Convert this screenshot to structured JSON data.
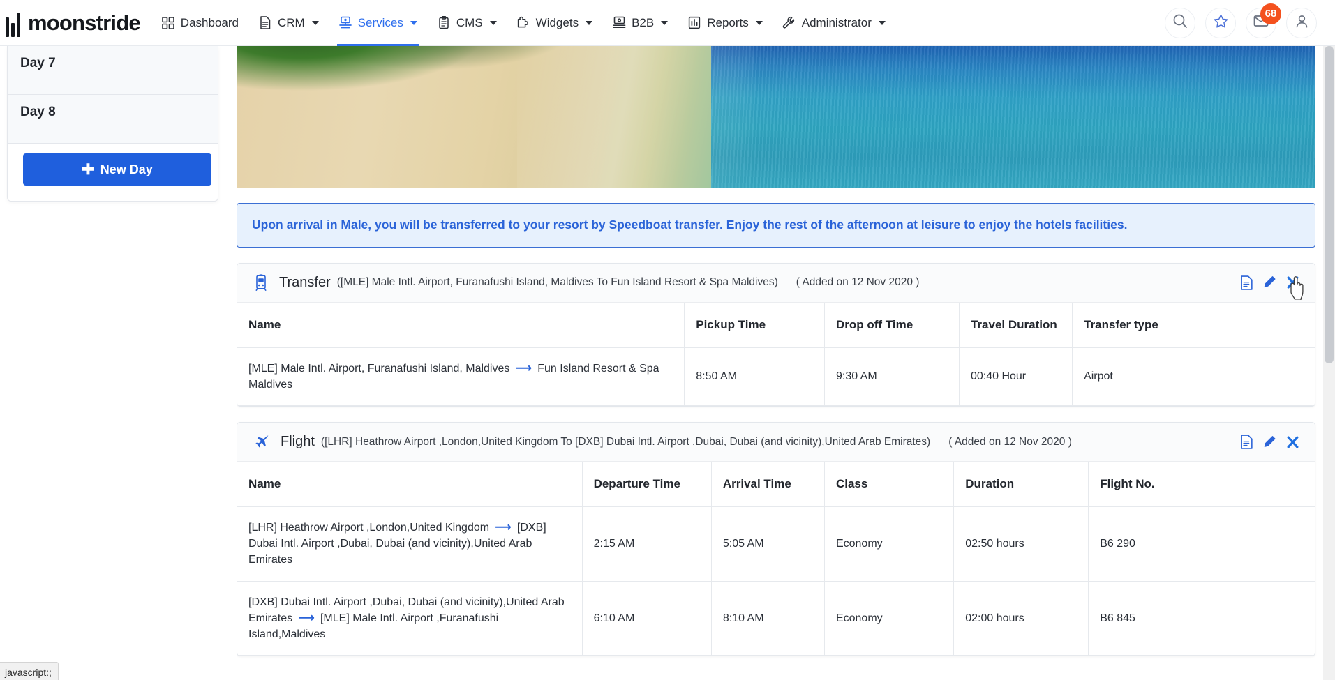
{
  "brand": {
    "name": "moonstride"
  },
  "nav": {
    "items": [
      {
        "label": "Dashboard",
        "icon": "grid-icon",
        "caret": false,
        "active": false
      },
      {
        "label": "CRM",
        "icon": "document-icon",
        "caret": true,
        "active": false
      },
      {
        "label": "Services",
        "icon": "services-icon",
        "caret": true,
        "active": true
      },
      {
        "label": "CMS",
        "icon": "clipboard-icon",
        "caret": true,
        "active": false
      },
      {
        "label": "Widgets",
        "icon": "puzzle-icon",
        "caret": true,
        "active": false
      },
      {
        "label": "B2B",
        "icon": "b2b-icon",
        "caret": true,
        "active": false
      },
      {
        "label": "Reports",
        "icon": "bar-chart-icon",
        "caret": true,
        "active": false
      },
      {
        "label": "Administrator",
        "icon": "wrench-icon",
        "caret": true,
        "active": false
      }
    ],
    "right_icons": [
      {
        "name": "search-icon"
      },
      {
        "name": "star-icon"
      },
      {
        "name": "envelope-icon",
        "badge": "68"
      },
      {
        "name": "user-icon"
      }
    ],
    "accent_color": "#2f6fed",
    "badge_color": "#f4511e"
  },
  "sidebar": {
    "days": [
      {
        "label": "Day 7"
      },
      {
        "label": "Day 8"
      }
    ],
    "new_day_button": "New Day",
    "new_day_icon": "plus-icon",
    "button_color": "#1f5fdd"
  },
  "hero": {
    "alt": "beach-banner-image"
  },
  "alert": {
    "text": "Upon arrival in Male, you will be transferred to your resort by Speedboat transfer. Enjoy the rest of the afternoon at leisure to enjoy the hotels facilities.",
    "text_color": "#2a63d8",
    "background": "#e7f1fd",
    "border_color": "#3b6fd4"
  },
  "transfer_card": {
    "icon": "transfer-vehicle-icon",
    "title": "Transfer",
    "subtitle": "([MLE] Male Intl. Airport, Furanafushi Island, Maldives To Fun Island Resort & Spa Maldives)",
    "added": "( Added on 12 Nov 2020 )",
    "actions": [
      {
        "name": "voucher-icon"
      },
      {
        "name": "edit-pencil-icon"
      },
      {
        "name": "delete-close-icon"
      }
    ],
    "columns": [
      "Name",
      "Pickup Time",
      "Drop off Time",
      "Travel Duration",
      "Transfer type"
    ],
    "rows": [
      {
        "name_from": "[MLE] Male Intl. Airport, Furanafushi Island, Maldives",
        "name_to": "Fun Island Resort & Spa Maldives",
        "pickup_time": "8:50 AM",
        "dropoff_time": "9:30 AM",
        "travel_duration": "00:40 Hour",
        "transfer_type": "Airpot"
      }
    ]
  },
  "flight_card": {
    "icon": "airplane-icon",
    "title": "Flight",
    "subtitle": "([LHR] Heathrow Airport ,London,United Kingdom To [DXB] Dubai Intl. Airport ,Dubai, Dubai (and vicinity),United Arab Emirates)",
    "added": "( Added on 12 Nov 2020 )",
    "actions": [
      {
        "name": "voucher-icon"
      },
      {
        "name": "edit-pencil-icon"
      },
      {
        "name": "delete-close-icon"
      }
    ],
    "columns": [
      "Name",
      "Departure Time",
      "Arrival Time",
      "Class",
      "Duration",
      "Flight No."
    ],
    "rows": [
      {
        "name_from": "[LHR] Heathrow Airport ,London,United Kingdom",
        "name_to": "[DXB] Dubai Intl. Airport ,Dubai, Dubai (and vicinity),United Arab Emirates",
        "departure_time": "2:15 AM",
        "arrival_time": "5:05 AM",
        "class": "Economy",
        "duration": "02:50 hours",
        "flight_no": "B6 290"
      },
      {
        "name_from": "[DXB] Dubai Intl. Airport ,Dubai, Dubai (and vicinity),United Arab Emirates",
        "name_to": "[MLE] Male Intl. Airport ,Furanafushi Island,Maldives",
        "departure_time": "6:10 AM",
        "arrival_time": "8:10 AM",
        "class": "Economy",
        "duration": "02:00 hours",
        "flight_no": "B6 845"
      }
    ]
  },
  "statusbar": {
    "text": "javascript:;"
  }
}
